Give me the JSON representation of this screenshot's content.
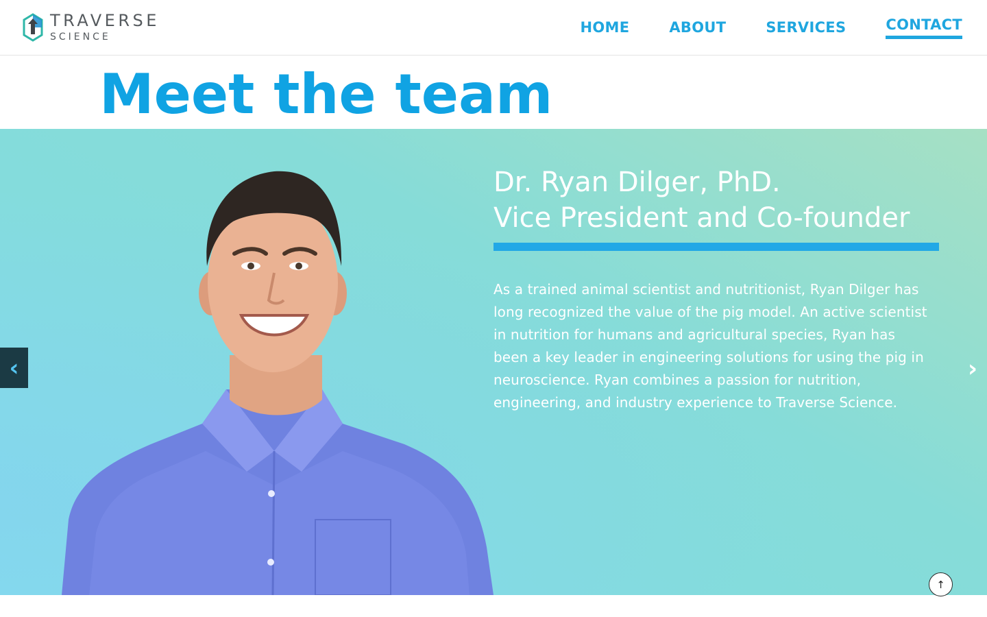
{
  "brand": {
    "name": "TRAVERSE",
    "tagline": "SCIENCE",
    "colors": {
      "primary": "#1fa6df",
      "logo_teal": "#2fb7a8",
      "logo_blue": "#1f8fd0",
      "logo_dark": "#3f4448"
    }
  },
  "nav": {
    "items": [
      {
        "label": "HOME",
        "active": false
      },
      {
        "label": "ABOUT",
        "active": false
      },
      {
        "label": "SERVICES",
        "active": false
      },
      {
        "label": "CONTACT",
        "active": true
      }
    ]
  },
  "page": {
    "title": "Meet the team"
  },
  "slide": {
    "name": "Dr. Ryan Dilger, PhD.",
    "role": "Vice President and Co-founder",
    "bio": "As a trained animal scientist and nutritionist, Ryan Dilger has long recognized the value of the pig model. An active scientist in nutrition for humans and agricultural species, Ryan has been a key leader in engineering solutions for using the pig in neuroscience. Ryan combines a passion for nutrition, engineering, and industry experience to Traverse Science.",
    "prev_icon": "‹",
    "next_icon": "›"
  },
  "scroll_top_icon": "↑"
}
